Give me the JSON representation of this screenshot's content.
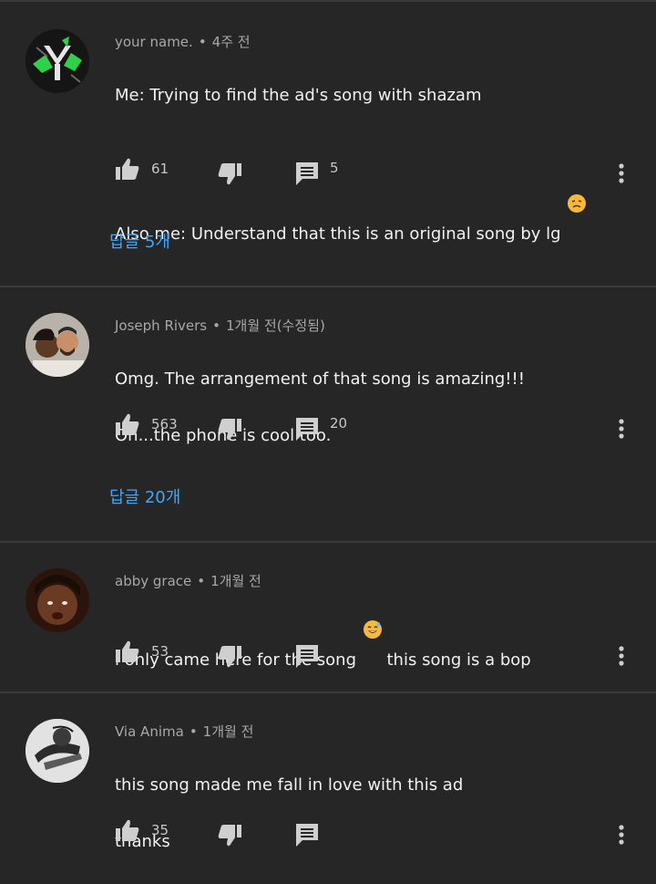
{
  "comments": [
    {
      "author": "your name.",
      "time": "4주 전",
      "lines": [
        "Me: Trying to find the ad's song with shazam",
        "",
        "Also me: Understand that this is an original song by lg"
      ],
      "emoji_after_last_line": "weary-face",
      "likes": "61",
      "reply_count": "5",
      "replies_link": "답글 5개"
    },
    {
      "author": "Joseph Rivers",
      "time": "1개월 전(수정됨)",
      "lines": [
        "Omg. The arrangement of that song is amazing!!!",
        "Oh...the phone is cool too."
      ],
      "likes": "563",
      "reply_count": "20",
      "replies_link": "답글 20개"
    },
    {
      "author": "abby grace",
      "time": "1개월 전",
      "line_before_emoji": "i only came here for the song",
      "emoji": "grinning-sweat-face",
      "line_after_emoji": "this song is a bop",
      "likes": "53"
    },
    {
      "author": "Via Anima",
      "time": "1개월 전",
      "lines": [
        "this song made me fall in love with this ad",
        "thanks"
      ],
      "likes": "35"
    }
  ],
  "colors": {
    "background": "#262626",
    "divider": "#3a3a3a",
    "link": "#3ea6ff",
    "meta": "#a8a8a8",
    "text": "#f1f1f1"
  },
  "icons": {
    "like": "thumb-up-icon",
    "dislike": "thumb-down-icon",
    "reply": "comment-icon",
    "more": "more-vert-icon"
  }
}
